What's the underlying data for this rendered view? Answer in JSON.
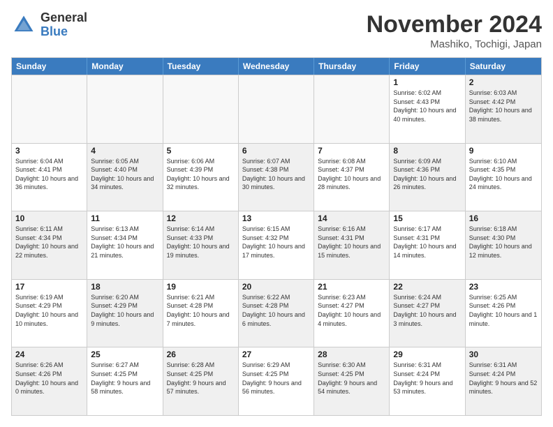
{
  "logo": {
    "general": "General",
    "blue": "Blue"
  },
  "title": "November 2024",
  "location": "Mashiko, Tochigi, Japan",
  "header_days": [
    "Sunday",
    "Monday",
    "Tuesday",
    "Wednesday",
    "Thursday",
    "Friday",
    "Saturday"
  ],
  "rows": [
    [
      {
        "day": "",
        "info": "",
        "empty": true
      },
      {
        "day": "",
        "info": "",
        "empty": true
      },
      {
        "day": "",
        "info": "",
        "empty": true
      },
      {
        "day": "",
        "info": "",
        "empty": true
      },
      {
        "day": "",
        "info": "",
        "empty": true
      },
      {
        "day": "1",
        "info": "Sunrise: 6:02 AM\nSunset: 4:43 PM\nDaylight: 10 hours and 40 minutes."
      },
      {
        "day": "2",
        "info": "Sunrise: 6:03 AM\nSunset: 4:42 PM\nDaylight: 10 hours and 38 minutes.",
        "shaded": true
      }
    ],
    [
      {
        "day": "3",
        "info": "Sunrise: 6:04 AM\nSunset: 4:41 PM\nDaylight: 10 hours and 36 minutes."
      },
      {
        "day": "4",
        "info": "Sunrise: 6:05 AM\nSunset: 4:40 PM\nDaylight: 10 hours and 34 minutes.",
        "shaded": true
      },
      {
        "day": "5",
        "info": "Sunrise: 6:06 AM\nSunset: 4:39 PM\nDaylight: 10 hours and 32 minutes."
      },
      {
        "day": "6",
        "info": "Sunrise: 6:07 AM\nSunset: 4:38 PM\nDaylight: 10 hours and 30 minutes.",
        "shaded": true
      },
      {
        "day": "7",
        "info": "Sunrise: 6:08 AM\nSunset: 4:37 PM\nDaylight: 10 hours and 28 minutes."
      },
      {
        "day": "8",
        "info": "Sunrise: 6:09 AM\nSunset: 4:36 PM\nDaylight: 10 hours and 26 minutes.",
        "shaded": true
      },
      {
        "day": "9",
        "info": "Sunrise: 6:10 AM\nSunset: 4:35 PM\nDaylight: 10 hours and 24 minutes."
      }
    ],
    [
      {
        "day": "10",
        "info": "Sunrise: 6:11 AM\nSunset: 4:34 PM\nDaylight: 10 hours and 22 minutes.",
        "shaded": true
      },
      {
        "day": "11",
        "info": "Sunrise: 6:13 AM\nSunset: 4:34 PM\nDaylight: 10 hours and 21 minutes."
      },
      {
        "day": "12",
        "info": "Sunrise: 6:14 AM\nSunset: 4:33 PM\nDaylight: 10 hours and 19 minutes.",
        "shaded": true
      },
      {
        "day": "13",
        "info": "Sunrise: 6:15 AM\nSunset: 4:32 PM\nDaylight: 10 hours and 17 minutes."
      },
      {
        "day": "14",
        "info": "Sunrise: 6:16 AM\nSunset: 4:31 PM\nDaylight: 10 hours and 15 minutes.",
        "shaded": true
      },
      {
        "day": "15",
        "info": "Sunrise: 6:17 AM\nSunset: 4:31 PM\nDaylight: 10 hours and 14 minutes."
      },
      {
        "day": "16",
        "info": "Sunrise: 6:18 AM\nSunset: 4:30 PM\nDaylight: 10 hours and 12 minutes.",
        "shaded": true
      }
    ],
    [
      {
        "day": "17",
        "info": "Sunrise: 6:19 AM\nSunset: 4:29 PM\nDaylight: 10 hours and 10 minutes."
      },
      {
        "day": "18",
        "info": "Sunrise: 6:20 AM\nSunset: 4:29 PM\nDaylight: 10 hours and 9 minutes.",
        "shaded": true
      },
      {
        "day": "19",
        "info": "Sunrise: 6:21 AM\nSunset: 4:28 PM\nDaylight: 10 hours and 7 minutes."
      },
      {
        "day": "20",
        "info": "Sunrise: 6:22 AM\nSunset: 4:28 PM\nDaylight: 10 hours and 6 minutes.",
        "shaded": true
      },
      {
        "day": "21",
        "info": "Sunrise: 6:23 AM\nSunset: 4:27 PM\nDaylight: 10 hours and 4 minutes."
      },
      {
        "day": "22",
        "info": "Sunrise: 6:24 AM\nSunset: 4:27 PM\nDaylight: 10 hours and 3 minutes.",
        "shaded": true
      },
      {
        "day": "23",
        "info": "Sunrise: 6:25 AM\nSunset: 4:26 PM\nDaylight: 10 hours and 1 minute."
      }
    ],
    [
      {
        "day": "24",
        "info": "Sunrise: 6:26 AM\nSunset: 4:26 PM\nDaylight: 10 hours and 0 minutes.",
        "shaded": true
      },
      {
        "day": "25",
        "info": "Sunrise: 6:27 AM\nSunset: 4:25 PM\nDaylight: 9 hours and 58 minutes."
      },
      {
        "day": "26",
        "info": "Sunrise: 6:28 AM\nSunset: 4:25 PM\nDaylight: 9 hours and 57 minutes.",
        "shaded": true
      },
      {
        "day": "27",
        "info": "Sunrise: 6:29 AM\nSunset: 4:25 PM\nDaylight: 9 hours and 56 minutes."
      },
      {
        "day": "28",
        "info": "Sunrise: 6:30 AM\nSunset: 4:25 PM\nDaylight: 9 hours and 54 minutes.",
        "shaded": true
      },
      {
        "day": "29",
        "info": "Sunrise: 6:31 AM\nSunset: 4:24 PM\nDaylight: 9 hours and 53 minutes."
      },
      {
        "day": "30",
        "info": "Sunrise: 6:31 AM\nSunset: 4:24 PM\nDaylight: 9 hours and 52 minutes.",
        "shaded": true
      }
    ]
  ]
}
